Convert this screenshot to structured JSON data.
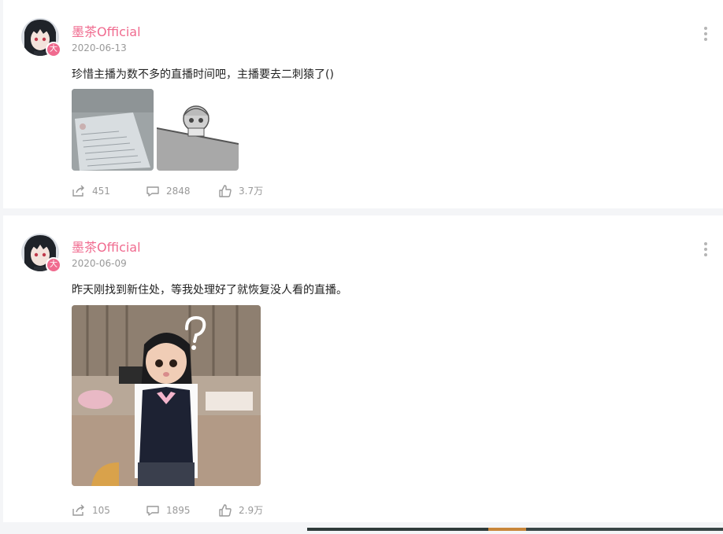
{
  "posts": [
    {
      "username": "墨茶Official",
      "date": "2020-06-13",
      "text": "珍惜主播为数不多的直播时间吧，主播要去二刺猿了()",
      "badge": "大",
      "images": [
        "document-photo",
        "cartoon-peeking-sticker"
      ],
      "stats": {
        "shares": "451",
        "comments": "2848",
        "likes": "3.7万"
      }
    },
    {
      "username": "墨茶Official",
      "date": "2020-06-09",
      "text": "昨天刚找到新住处，等我处理好了就恢复没人看的直播。",
      "badge": "大",
      "images": [
        "masked-person-question-photo"
      ],
      "stats": {
        "shares": "105",
        "comments": "1895",
        "likes": "2.9万"
      }
    }
  ],
  "colors": {
    "accent": "#f06b8f",
    "muted": "#999999",
    "background": "#f4f5f7"
  },
  "icons": [
    "share-icon",
    "comment-icon",
    "like-icon",
    "more-icon"
  ]
}
